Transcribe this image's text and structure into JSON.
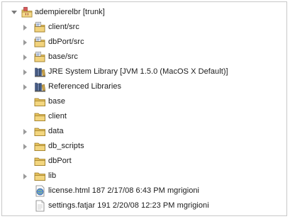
{
  "tree": {
    "root": {
      "label": "adempierelbr [trunk]",
      "icon": "java-project-icon",
      "state": "expanded"
    },
    "items": [
      {
        "label": "client/src",
        "icon": "source-folder-icon",
        "state": "collapsed"
      },
      {
        "label": "dbPort/src",
        "icon": "source-folder-icon",
        "state": "collapsed"
      },
      {
        "label": "base/src",
        "icon": "source-folder-icon",
        "state": "collapsed"
      },
      {
        "label": "JRE System Library [JVM 1.5.0 (MacOS X Default)]",
        "icon": "library-icon",
        "state": "collapsed"
      },
      {
        "label": "Referenced Libraries",
        "icon": "library-icon",
        "state": "collapsed"
      },
      {
        "label": "base",
        "icon": "folder-icon",
        "state": "none"
      },
      {
        "label": "client",
        "icon": "folder-icon",
        "state": "none"
      },
      {
        "label": "data",
        "icon": "folder-icon",
        "state": "collapsed"
      },
      {
        "label": "db_scripts",
        "icon": "folder-icon",
        "state": "collapsed"
      },
      {
        "label": "dbPort",
        "icon": "folder-icon",
        "state": "none"
      },
      {
        "label": "lib",
        "icon": "folder-icon",
        "state": "collapsed"
      },
      {
        "label": "license.html 187  2/17/08 6:43 PM  mgrigioni",
        "icon": "html-file-icon",
        "state": "none"
      },
      {
        "label": "settings.fatjar 191  2/20/08 12:23 PM  mgrigioni",
        "icon": "file-icon",
        "state": "none"
      }
    ]
  }
}
